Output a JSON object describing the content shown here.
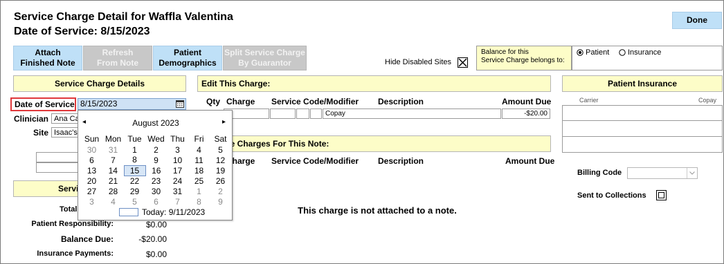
{
  "header": {
    "title_line1": "Service Charge Detail for Waffla Valentina",
    "title_line2": "Date of Service: 8/15/2023",
    "done_label": "Done"
  },
  "toolbar": {
    "attach_line1": "Attach",
    "attach_line2": "Finished Note",
    "refresh_line1": "Refresh",
    "refresh_line2": "From Note",
    "patient_demo_line1": "Patient",
    "patient_demo_line2": "Demographics",
    "split_line1": "Split Service Charge",
    "split_line2": "By Guarantor",
    "hide_disabled_label": "Hide Disabled Sites",
    "hide_disabled_checked": true
  },
  "balance": {
    "label_line1": "Balance for this",
    "label_line2": "Service Charge belongs to:",
    "option_patient": "Patient",
    "option_insurance": "Insurance",
    "selected": "Patient"
  },
  "details": {
    "header": "Service Charge Details",
    "date_label": "Date of Service",
    "date_value": "8/15/2023",
    "clinician_label": "Clinician",
    "clinician_value": "Ana Ca",
    "site_label": "Site",
    "site_value": "Isaac's"
  },
  "summary": {
    "header_partial": "Servi",
    "total_label": "Total",
    "patient_resp_label": "Patient Responsibility:",
    "patient_resp_value": "$0.00",
    "balance_due_label": "Balance Due:",
    "balance_due_value": "-$20.00",
    "ins_payments_label": "Insurance Payments:",
    "ins_payments_value": "$0.00"
  },
  "edit_charge": {
    "header": "Edit This Charge:",
    "columns": [
      "Qty",
      "Charge",
      "Service Code/Modifier",
      "Description",
      "Amount Due"
    ],
    "row": {
      "description": "Copay",
      "amount_due": "-$20.00"
    }
  },
  "note_charges": {
    "header_partial": "ce Charges For This Note:",
    "columns": [
      "Charge",
      "Service Code/Modifier",
      "Description",
      "Amount Due"
    ],
    "empty_message": "This charge is not attached to a note."
  },
  "insurance": {
    "header": "Patient Insurance",
    "carrier_label": "Carrier",
    "copay_label": "Copay",
    "billing_code_label": "Billing Code",
    "sent_collections_label": "Sent to Collections"
  },
  "calendar": {
    "month_label": "August 2023",
    "prev_icon": "◂",
    "next_icon": "▸",
    "weekdays": [
      "Sun",
      "Mon",
      "Tue",
      "Wed",
      "Thu",
      "Fri",
      "Sat"
    ],
    "weeks": [
      [
        "30",
        "31",
        "1",
        "2",
        "3",
        "4",
        "5"
      ],
      [
        "6",
        "7",
        "8",
        "9",
        "10",
        "11",
        "12"
      ],
      [
        "13",
        "14",
        "15",
        "16",
        "17",
        "18",
        "19"
      ],
      [
        "20",
        "21",
        "22",
        "23",
        "24",
        "25",
        "26"
      ],
      [
        "27",
        "28",
        "29",
        "30",
        "31",
        "1",
        "2"
      ],
      [
        "3",
        "4",
        "5",
        "6",
        "7",
        "8",
        "9"
      ]
    ],
    "selected_day": "15",
    "today_label": "Today: 9/11/2023"
  }
}
